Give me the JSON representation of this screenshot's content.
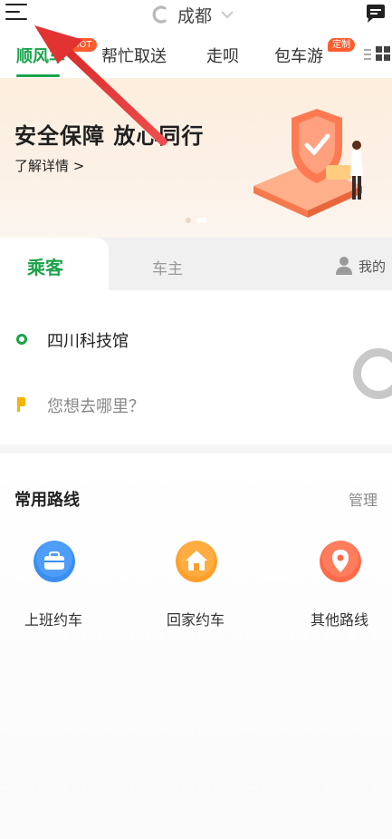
{
  "header": {
    "city": "成都"
  },
  "tabs": [
    {
      "label": "顺风车",
      "badge": "HOT"
    },
    {
      "label": "帮忙取送"
    },
    {
      "label": "走呗"
    },
    {
      "label": "包车游",
      "badge": "定制"
    }
  ],
  "banner": {
    "title": "安全保障 放心同行",
    "subtitle": "了解详情 >"
  },
  "role_tabs": {
    "passenger": "乘客",
    "driver": "车主",
    "my": "我的"
  },
  "address": {
    "origin": "四川科技馆",
    "destination_placeholder": "您想去哪里？"
  },
  "routes": {
    "title": "常用路线",
    "manage": "管理",
    "items": [
      {
        "label": "上班约车",
        "icon": "briefcase-icon",
        "color": "#3a8ef0"
      },
      {
        "label": "回家约车",
        "icon": "home-icon",
        "color": "#ff9e2b"
      },
      {
        "label": "其他路线",
        "icon": "location-pin-icon",
        "color": "#ff6a4a"
      }
    ]
  },
  "colors": {
    "accent": "#1aa34a",
    "badge": "#ff5b2e",
    "arrow": "#e83a3a"
  }
}
